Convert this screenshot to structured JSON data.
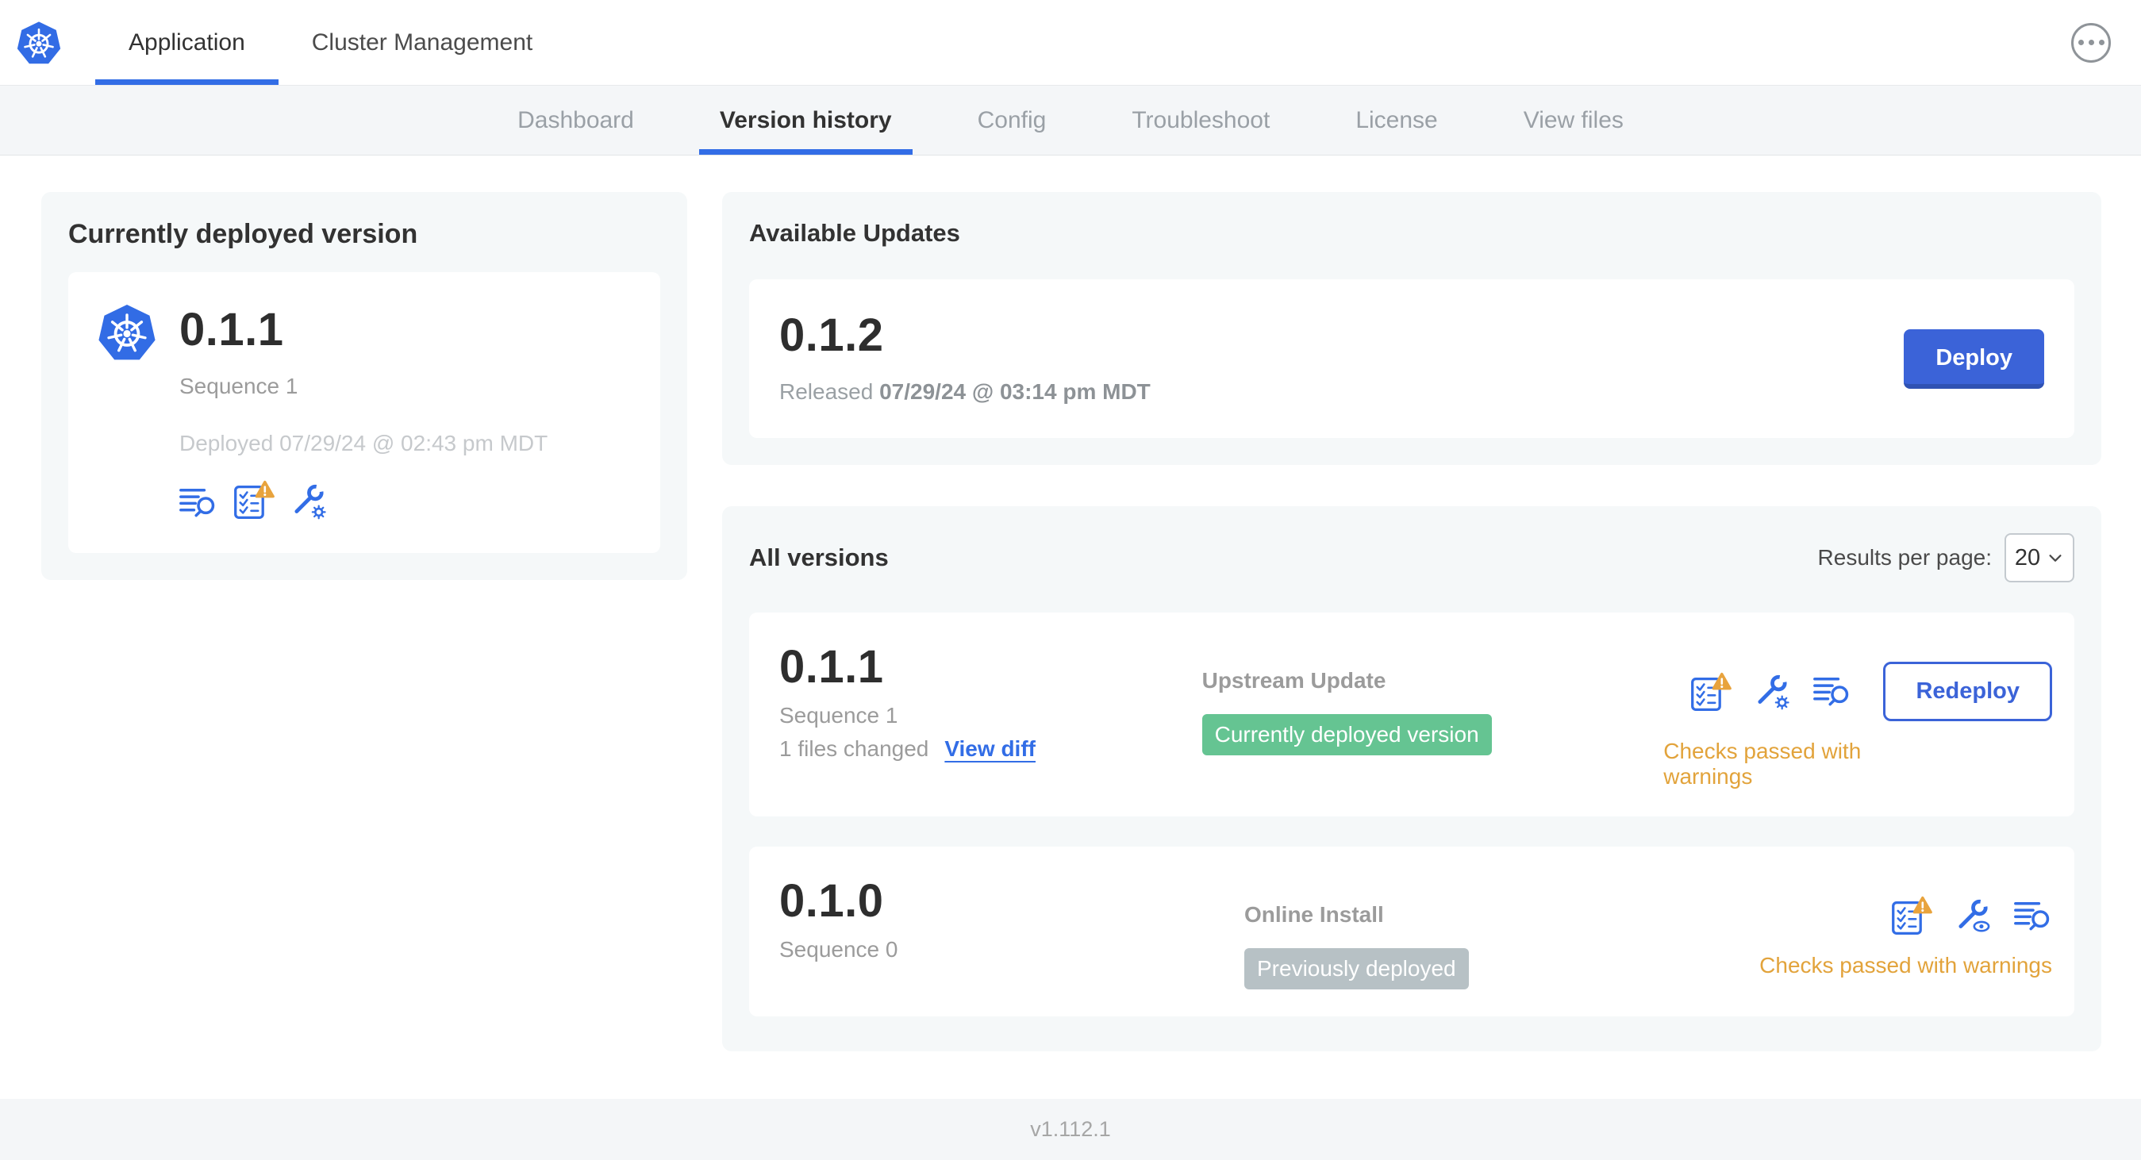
{
  "header": {
    "tabs": [
      {
        "label": "Application",
        "active": true
      },
      {
        "label": "Cluster Management",
        "active": false
      }
    ],
    "more_menu_icon": "ellipsis-in-circle"
  },
  "subnav": {
    "tabs": [
      "Dashboard",
      "Version history",
      "Config",
      "Troubleshoot",
      "License",
      "View files"
    ],
    "active_tab": "Version history"
  },
  "currently_deployed": {
    "title": "Currently deployed version",
    "version": "0.1.1",
    "sequence": "Sequence 1",
    "deployed_at": "Deployed 07/29/24 @ 02:43 pm MDT",
    "icons": [
      "view-logs-icon",
      "preflight-warning-icon",
      "edit-config-icon"
    ],
    "logo_icon": "kubernetes-logo"
  },
  "available_updates": {
    "title": "Available Updates",
    "version": "0.1.2",
    "released_label": "Released",
    "released_at": "07/29/24 @ 03:14 pm MDT",
    "deploy_label": "Deploy"
  },
  "all_versions": {
    "title": "All versions",
    "results_per_page_label": "Results per page:",
    "results_per_page_value": "20",
    "rows": [
      {
        "version": "0.1.1",
        "sequence": "Sequence 1",
        "files_changed": "1 files changed",
        "view_diff_label": "View diff",
        "source": "Upstream Update",
        "badge": "Currently deployed version",
        "badge_color": "#65c492",
        "icons": [
          "preflight-warning-icon",
          "edit-config-icon",
          "view-logs-icon"
        ],
        "action_label": "Redeploy",
        "status": "Checks passed with warnings",
        "status_color": "#e2a33b"
      },
      {
        "version": "0.1.0",
        "sequence": "Sequence 0",
        "source": "Online Install",
        "badge": "Previously deployed",
        "badge_color": "#b7c1c5",
        "icons": [
          "preflight-warning-icon",
          "view-config-icon",
          "view-logs-icon"
        ],
        "status": "Checks passed with warnings",
        "status_color": "#e2a33b"
      }
    ]
  },
  "footer": {
    "app_version": "v1.112.1"
  },
  "colors": {
    "accent_blue": "#326de6",
    "button_blue": "#3b63d8",
    "badge_green": "#65c492",
    "badge_gray": "#b7c1c5",
    "warning_amber": "#e2a33b",
    "panel_bg": "#f5f8f9",
    "subnav_bg": "#f4f6f8"
  }
}
